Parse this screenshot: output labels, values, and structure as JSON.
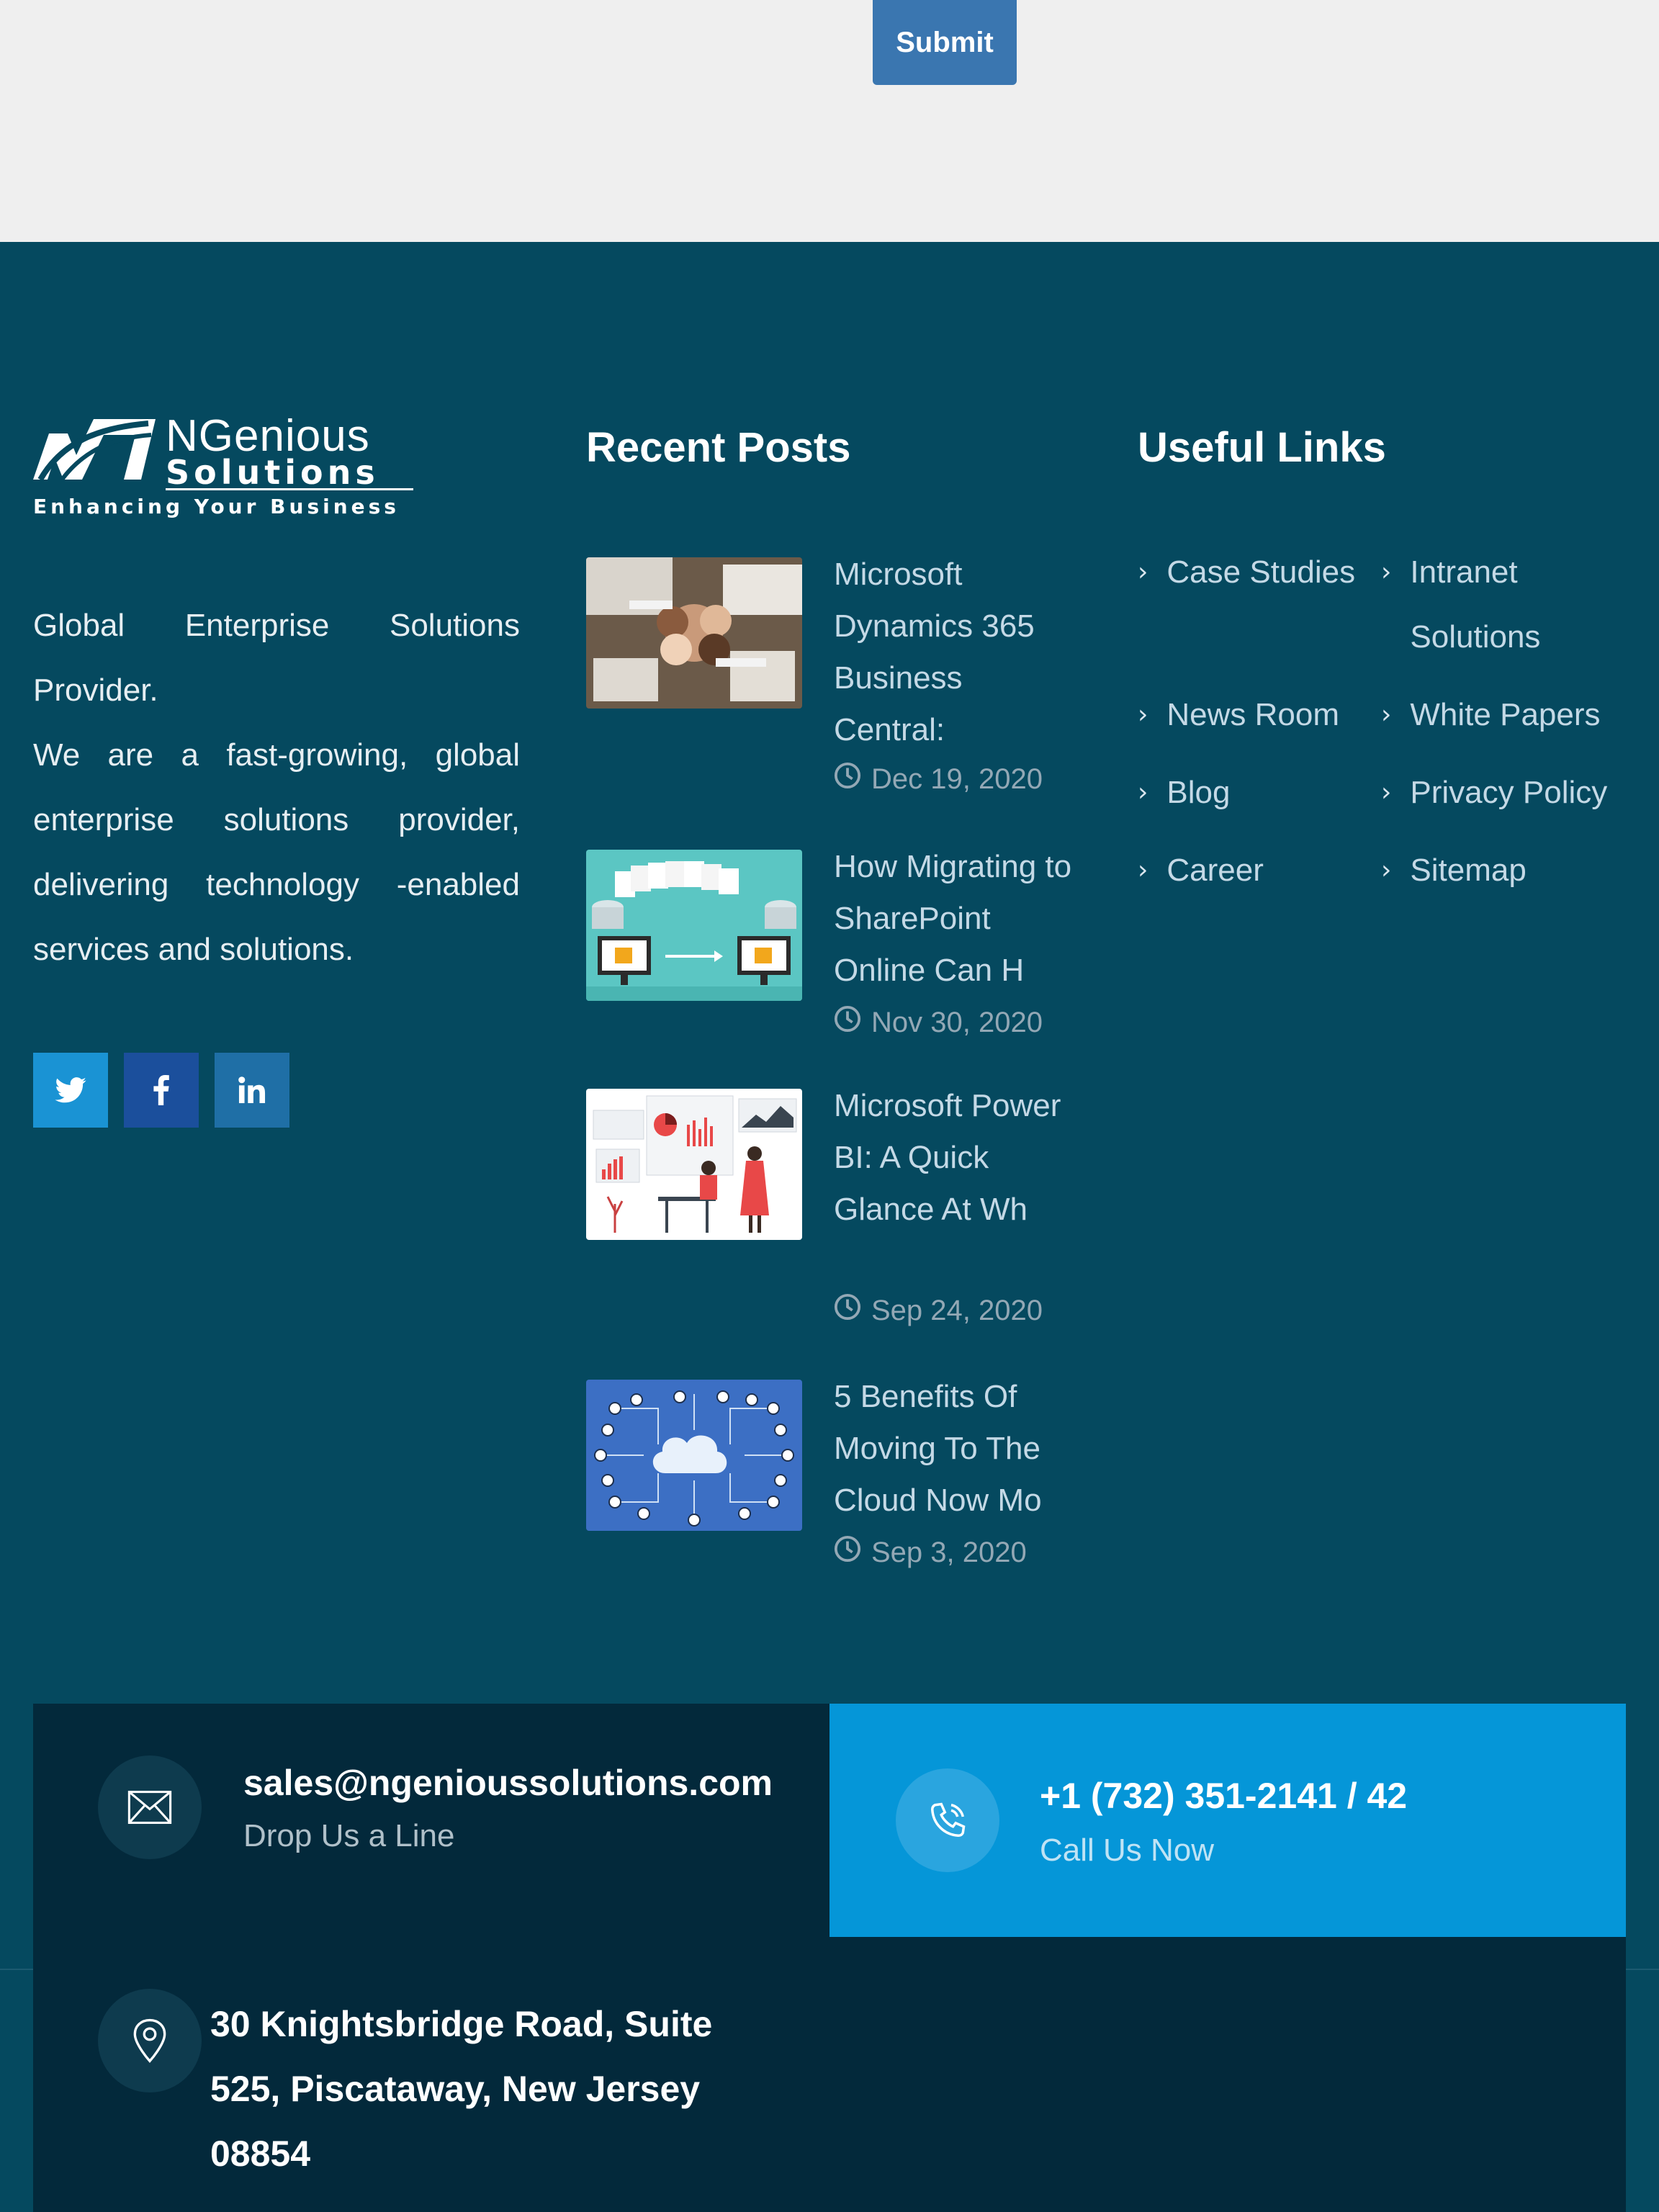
{
  "form": {
    "submit_label": "Submit"
  },
  "brand": {
    "name_line1": "NGenious",
    "name_line2": "Solutions",
    "tagline": "Enhancing Your Business"
  },
  "about": {
    "line1": "Global Enterprise Solutions Provider.",
    "line2": "We are a fast-growing, global enterprise solutions provider, delivering technology -enabled services and solutions."
  },
  "social": {
    "twitter_icon": "twitter-icon",
    "facebook_icon": "facebook-icon",
    "linkedin_icon": "linkedin-icon"
  },
  "recent_posts": {
    "title": "Recent Posts",
    "posts": [
      {
        "title": "Microsoft Dynamics 365 Business Central:",
        "date": "Dec 19, 2020"
      },
      {
        "title": "How Migrating to SharePoint Online Can H",
        "date": "Nov 30, 2020"
      },
      {
        "title": "Microsoft Power BI: A Quick Glance At Wh",
        "date": "Sep 24, 2020"
      },
      {
        "title": "5 Benefits Of Moving To The Cloud Now Mo",
        "date": "Sep 3, 2020"
      }
    ]
  },
  "useful_links": {
    "title": "Useful Links",
    "items": [
      "Case Studies",
      "Intranet Solutions",
      "News Room",
      "White Papers",
      "Blog",
      "Privacy Policy",
      "Career",
      "Sitemap"
    ]
  },
  "contact": {
    "email": "sales@ngenioussolutions.com",
    "email_sub": "Drop Us a Line",
    "phone": "+1 (732) 351-2141 / 42",
    "phone_sub": "Call Us Now",
    "address": "30 Knightsbridge Road, Suite 525, Piscataway, New Jersey 08854"
  },
  "colors": {
    "footer_bg": "#05495f",
    "panel_dark": "#03293b",
    "accent_blue": "#0596d8",
    "submit": "#3a76b0"
  }
}
